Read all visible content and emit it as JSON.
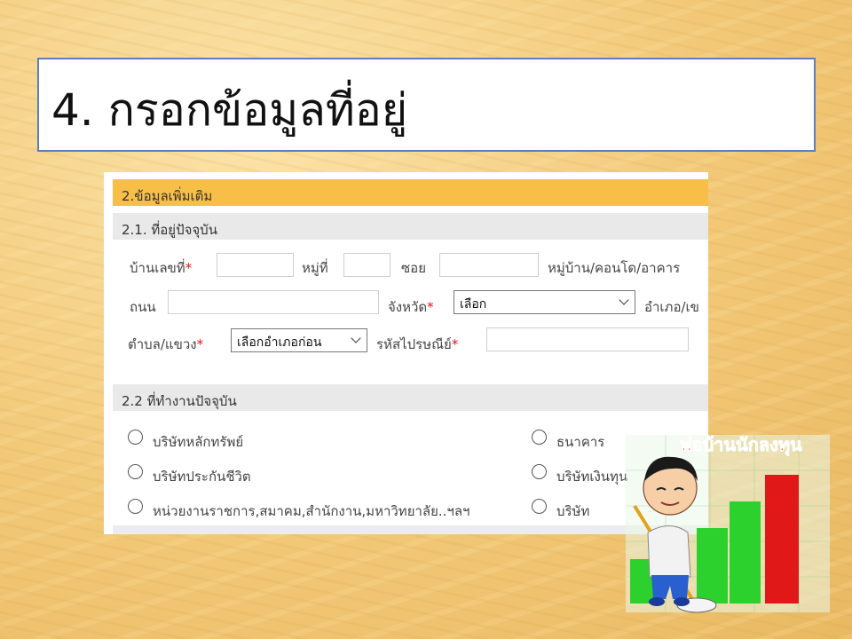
{
  "slide": {
    "title": "4. กรอกข้อมูลที่อยู่"
  },
  "form": {
    "section_main": "2.ข้อมูลเพิ่มเติม",
    "section_address": "2.1. ที่อยู่ปัจจุบัน",
    "house_no_label": "บ้านเลขที่",
    "moo_label": "หมู่ที่",
    "soi_label": "ซอย",
    "village_label": "หมู่บ้าน/คอนโด/อาคาร",
    "road_label": "ถนน",
    "province_label": "จังหวัด",
    "province_value": "เลือก",
    "district_label": "อำเภอ/เข",
    "subdistrict_label": "ตำบล/แขวง",
    "subdistrict_value": "เลือกอำเภอก่อน",
    "postcode_label": "รหัสไปรษณีย์",
    "required_mark": "*",
    "section_work": "2.2 ที่ทำงานปัจจุบัน",
    "work_options": [
      "บริษัทหลักทรัพย์",
      "ธนาคาร",
      "บริษัทประกันชีวิต",
      "บริษัทเงินทุน",
      "หน่วยงานราชการ,สมาคม,สำนักงาน,มหาวิทยาลัย..ฯลฯ",
      "บริษัท"
    ]
  },
  "mascot": {
    "caption": "พ่อบ้านนักลงทุน"
  },
  "colors": {
    "section_main_bg": "#f7bf47",
    "section_bg": "#e9e9e9",
    "required": "#ee1111",
    "title_border": "#5b7fbe",
    "chart_green": "#2dd12d",
    "chart_red": "#e01818"
  }
}
